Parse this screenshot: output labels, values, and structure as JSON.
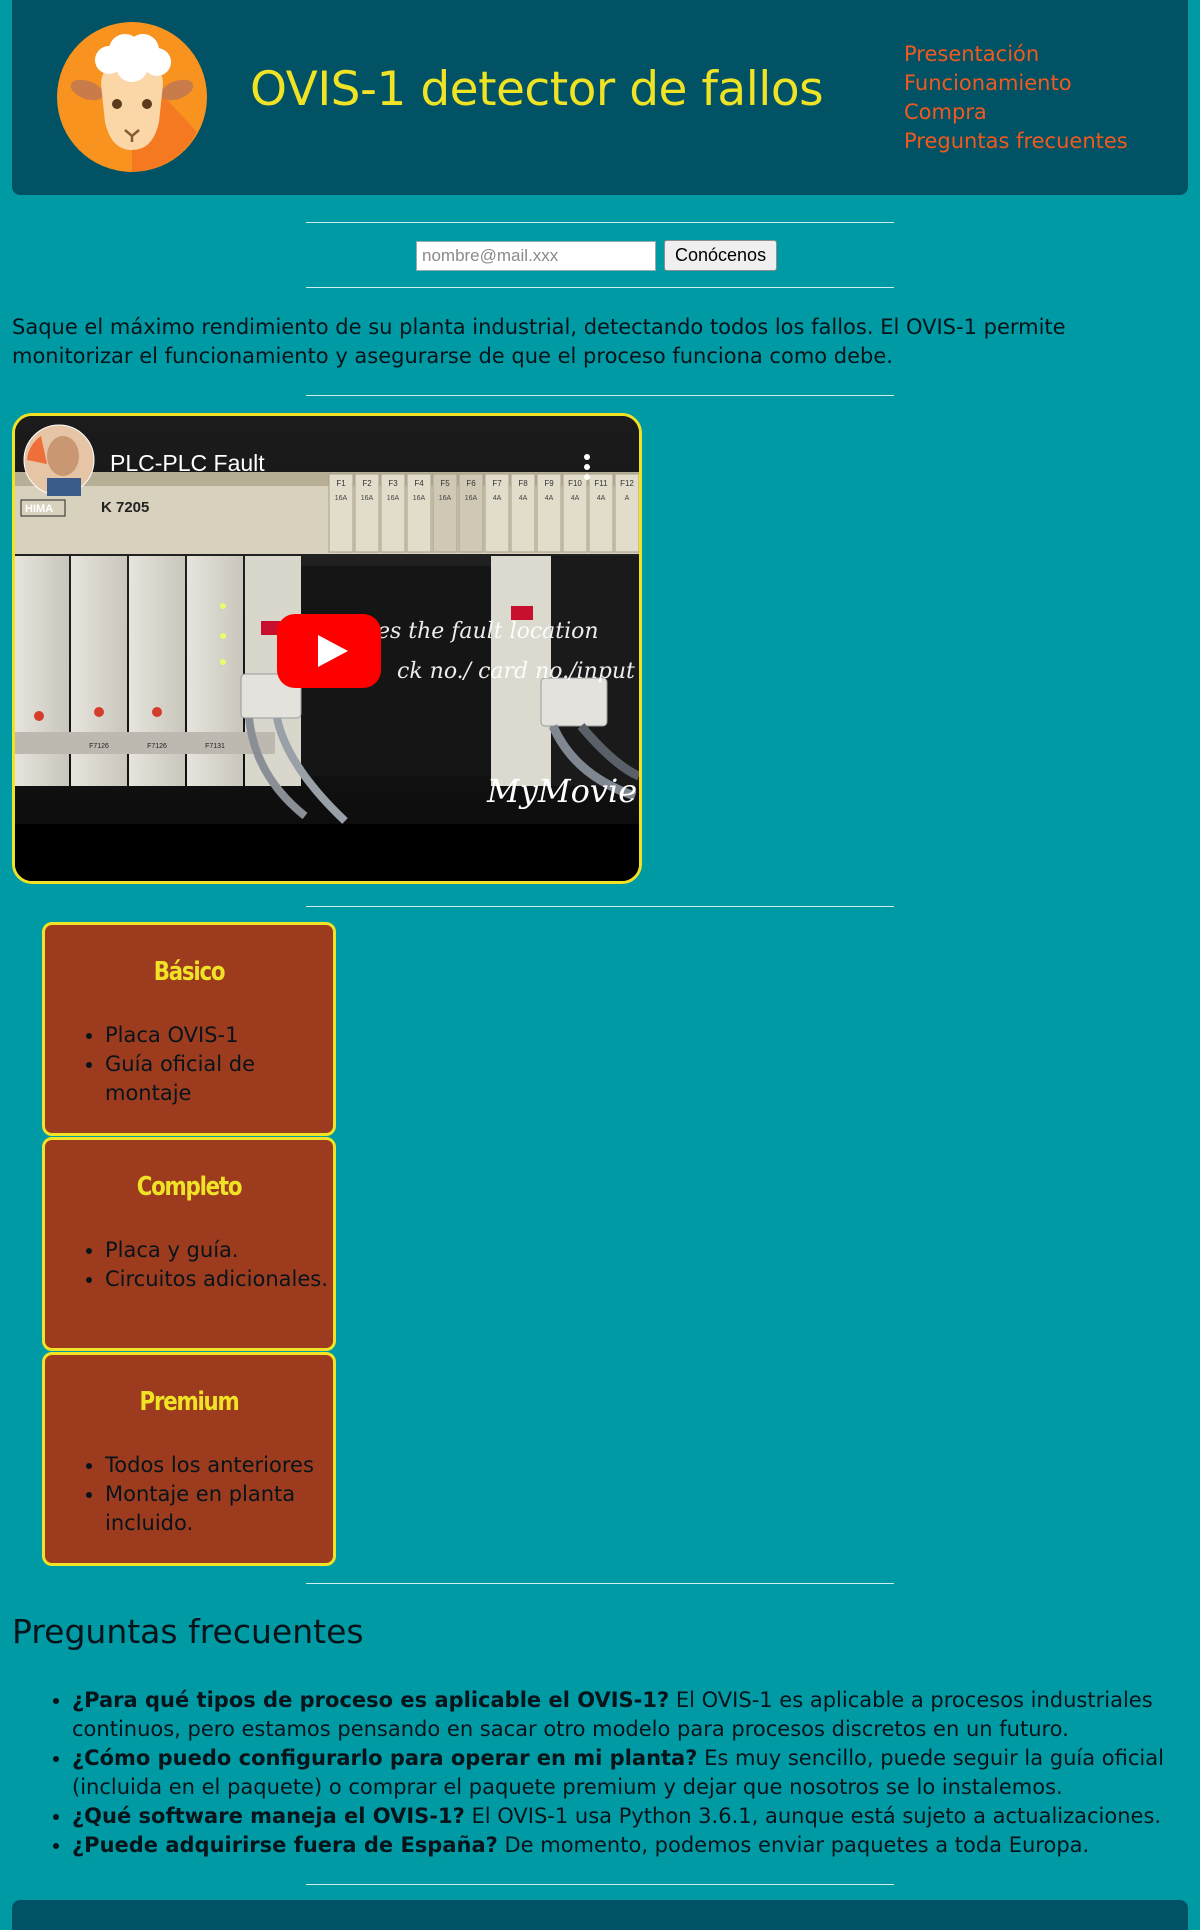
{
  "header": {
    "title": "OVIS-1 detector de fallos",
    "logo_icon": "sheep-icon",
    "nav": [
      {
        "label": "Presentación"
      },
      {
        "label": "Funcionamiento"
      },
      {
        "label": "Compra"
      },
      {
        "label": "Preguntas frecuentes"
      }
    ]
  },
  "signup": {
    "placeholder": "nombre@mail.xxx",
    "value": "",
    "button_label": "Conócenos"
  },
  "intro": "Saque el máximo rendimiento de su planta industrial, detectando todos los fallos. El OVIS-1 permite monitorizar el funcionamiento y asegurarse de que el proceso funciona como debe.",
  "video": {
    "title": "PLC-PLC Fault",
    "play_icon": "youtube-play-icon",
    "menu_icon": "more-vertical-icon",
    "overlay_line1": "ates the fault location",
    "overlay_line2": "ck no./ card no./input no.",
    "watermark": "MyMovie",
    "module_label": "K 7205",
    "brand_label": "HIMA",
    "fuse_labels": [
      "F1",
      "F2",
      "F3",
      "F4",
      "F5",
      "F6",
      "F7",
      "F8",
      "F9",
      "F10",
      "F11",
      "F12"
    ],
    "fuse_ratings": [
      "16A",
      "16A",
      "16A",
      "16A",
      "16A",
      "16A",
      "4A",
      "4A",
      "4A",
      "4A",
      "4A",
      "A"
    ],
    "card_labels": [
      "F7126",
      "F7126",
      "F7131"
    ]
  },
  "plans": [
    {
      "name": "Básico",
      "items": [
        "Placa OVIS-1",
        "Guía oficial de montaje"
      ]
    },
    {
      "name": "Completo",
      "items": [
        "Placa y guía.",
        "Circuitos adicionales."
      ]
    },
    {
      "name": "Premium",
      "items": [
        "Todos los anteriores",
        "Montaje en planta incluido."
      ]
    }
  ],
  "faq": {
    "title": "Preguntas frecuentes",
    "items": [
      {
        "q": "¿Para qué tipos de proceso es aplicable el OVIS-1?",
        "a": " El OVIS-1 es aplicable a procesos industriales continuos, pero estamos pensando en sacar otro modelo para procesos discretos en un futuro."
      },
      {
        "q": "¿Cómo puedo configurarlo para operar en mi planta?",
        "a": " Es muy sencillo, puede seguir la guía oficial (incluida en el paquete) o comprar el paquete premium y dejar que nosotros se lo instalemos."
      },
      {
        "q": "¿Qué software maneja el OVIS-1?",
        "a": " El OVIS-1 usa Python 3.6.1, aunque está sujeto a actualizaciones."
      },
      {
        "q": "¿Puede adquirirse fuera de España?",
        "a": " De momento, podemos enviar paquetes a toda Europa."
      }
    ]
  },
  "colors": {
    "background": "#009aa5",
    "header": "#005264",
    "title": "#f0e225",
    "nav_link": "#f05a1e",
    "plan_card": "#9c3b1e"
  }
}
